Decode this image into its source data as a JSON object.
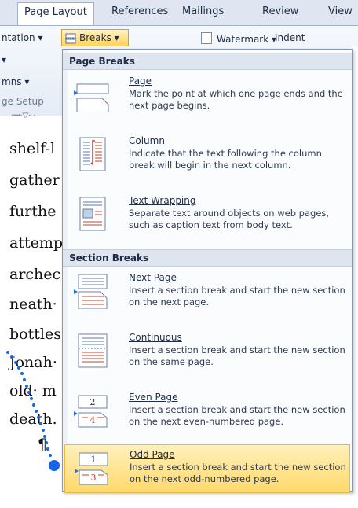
{
  "ribbon": {
    "tabs": [
      {
        "label": "Page Layout",
        "active": true
      },
      {
        "label": "References",
        "active": false
      },
      {
        "label": "Mailings",
        "active": false
      },
      {
        "label": "Review",
        "active": false
      },
      {
        "label": "View",
        "active": false
      }
    ],
    "orientation_label": "ntation",
    "breaks_label": "Breaks",
    "watermark_label": "Watermark",
    "indent_label": "Indent",
    "columns_label": "mns",
    "page_setup_label": "ge Setup"
  },
  "document": {
    "lines": [
      "shelf-l",
      "gather",
      "furthe",
      "attemp",
      "archec",
      "neath·",
      "bottles",
      "Jonah·",
      "old· m",
      "death.",
      "¶"
    ]
  },
  "menu": {
    "page_breaks_heading": "Page Breaks",
    "section_breaks_heading": "Section Breaks",
    "items": [
      {
        "title": "Page",
        "description": "Mark the point at which one page ends and the next page begins.",
        "icon": "page-break-icon"
      },
      {
        "title": "Column",
        "description": "Indicate that the text following the column break will begin in the next column.",
        "icon": "column-break-icon"
      },
      {
        "title": "Text Wrapping",
        "description": "Separate text around objects on web pages, such as caption text from body text.",
        "icon": "text-wrapping-icon"
      },
      {
        "title": "Next Page",
        "description": "Insert a section break and start the new section on the next page.",
        "icon": "next-page-icon"
      },
      {
        "title": "Continuous",
        "description": "Insert a section break and start the new section on the same page.",
        "icon": "continuous-icon"
      },
      {
        "title": "Even Page",
        "description": "Insert a section break and start the new section on the next even-numbered page.",
        "icon": "even-page-icon",
        "badge_top": "2",
        "badge_bottom": "4"
      },
      {
        "title": "Odd Page",
        "description": "Insert a section break and start the new section on the next odd-numbered page.",
        "icon": "odd-page-icon",
        "badge_top": "1",
        "badge_bottom": "3",
        "highlighted": true
      }
    ]
  },
  "colors": {
    "accent": "#1565e6",
    "highlight": "#ffd96b"
  }
}
